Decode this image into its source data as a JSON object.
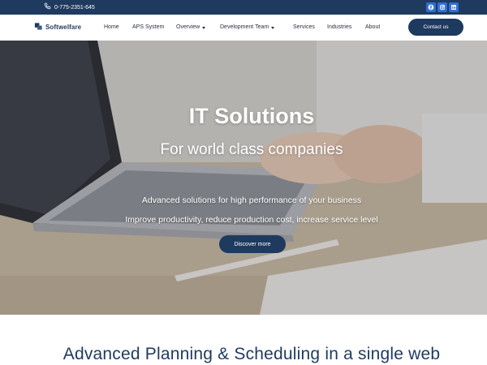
{
  "topbar": {
    "phone": "0-775-2351-645",
    "social_icons": [
      "facebook-icon",
      "instagram-icon",
      "linkedin-icon"
    ],
    "accent_color": "#2f6fd6"
  },
  "header": {
    "logo_text": "Softwelfare",
    "nav": [
      {
        "label": "Home",
        "dropdown": false
      },
      {
        "label": "APS System",
        "dropdown": false
      },
      {
        "label": "Overview",
        "dropdown": true
      },
      {
        "label": "Development Team",
        "dropdown": true
      },
      {
        "label": "Services",
        "dropdown": false
      },
      {
        "label": "Industries",
        "dropdown": false
      },
      {
        "label": "About",
        "dropdown": false
      }
    ],
    "contact_label": "Contact us"
  },
  "hero": {
    "title": "IT Solutions",
    "subtitle": "For world class companies",
    "line1": "Advanced solutions for high performance of your business",
    "line2": "Improve productivity, reduce production cost, increase service level",
    "button_label": "Discover more"
  },
  "section": {
    "heading": "Advanced Planning & Scheduling in a single web"
  },
  "colors": {
    "brand_dark": "#1f3a5f",
    "white": "#ffffff"
  }
}
